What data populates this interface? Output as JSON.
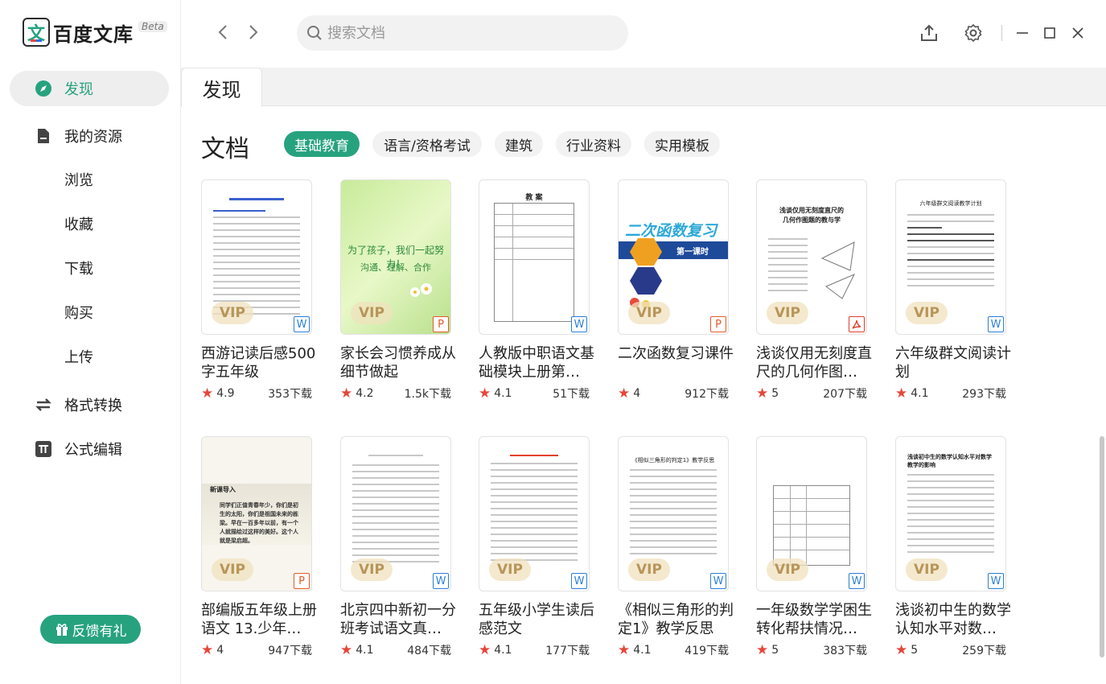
{
  "app": {
    "logo_text": "百度文库",
    "logo_char": "文",
    "beta": "Beta"
  },
  "search": {
    "placeholder": "搜索文档"
  },
  "sidebar": {
    "items": [
      {
        "label": "发现"
      },
      {
        "label": "我的资源"
      },
      {
        "label": "浏览"
      },
      {
        "label": "收藏"
      },
      {
        "label": "下载"
      },
      {
        "label": "购买"
      },
      {
        "label": "上传"
      },
      {
        "label": "格式转换"
      },
      {
        "label": "公式编辑"
      }
    ],
    "feedback": "反馈有礼"
  },
  "tabs": [
    {
      "label": "发现"
    }
  ],
  "section": {
    "title": "文档",
    "chips": [
      {
        "label": "基础教育",
        "active": true
      },
      {
        "label": "语言/资格考试"
      },
      {
        "label": "建筑"
      },
      {
        "label": "行业资料"
      },
      {
        "label": "实用模板"
      }
    ]
  },
  "docs": [
    {
      "title": "西游记读后感500字五年级",
      "rating": "4.9",
      "downloads": "353下载",
      "type": "W",
      "vip": "VIP"
    },
    {
      "title": "家长会习惯养成从细节做起",
      "rating": "4.2",
      "downloads": "1.5k下载",
      "type": "P",
      "vip": "VIP",
      "thumb_text": [
        "为了孩子，我们一起努力！",
        "沟通、理解、合作"
      ]
    },
    {
      "title": "人教版中职语文基础模块上册第…",
      "rating": "4.1",
      "downloads": "51下载",
      "type": "W",
      "thumb_text": [
        "教 案"
      ]
    },
    {
      "title": "二次函数复习课件",
      "rating": "4",
      "downloads": "912下载",
      "type": "P",
      "vip": "VIP",
      "thumb_text": [
        "二次函数复习",
        "第一课时"
      ]
    },
    {
      "title": "浅谈仅用无刻度直尺的几何作图…",
      "rating": "5",
      "downloads": "207下载",
      "type": "PDF",
      "vip": "VIP",
      "thumb_text": [
        "浅谈仅用无刻度直尺的",
        "几何作图题的教与学"
      ]
    },
    {
      "title": "六年级群文阅读计划",
      "rating": "4.1",
      "downloads": "293下载",
      "type": "W",
      "vip": "VIP",
      "thumb_text": [
        "六年级群文阅读教学计划"
      ]
    },
    {
      "title": "部编版五年级上册语文 13.少年…",
      "rating": "4",
      "downloads": "947下载",
      "type": "P",
      "vip": "VIP",
      "thumb_text": [
        "新课导入",
        "同学们正值青春年少，你们是初生的太阳，你们是祖国未来的栋梁。早在一百多年以前，有一个人就描绘过这样的美好。这个人就是梁启超。"
      ]
    },
    {
      "title": "北京四中新初一分班考试语文真…",
      "rating": "4.1",
      "downloads": "484下载",
      "type": "W",
      "vip": "VIP"
    },
    {
      "title": "五年级小学生读后感范文",
      "rating": "4.1",
      "downloads": "177下载",
      "type": "W",
      "vip": "VIP"
    },
    {
      "title": "《相似三角形的判定1》教学反思",
      "rating": "4.1",
      "downloads": "419下载",
      "type": "W",
      "vip": "VIP",
      "thumb_text": [
        "《相似三角形的判定1》教学反思"
      ]
    },
    {
      "title": "一年级数学学困生转化帮扶情况…",
      "rating": "5",
      "downloads": "383下载",
      "type": "W",
      "vip": "VIP"
    },
    {
      "title": "浅谈初中生的数学认知水平对数…",
      "rating": "5",
      "downloads": "259下载",
      "type": "W",
      "vip": "VIP",
      "thumb_text": [
        "浅谈初中生的数学认知水平对数学教学的影响"
      ]
    }
  ]
}
